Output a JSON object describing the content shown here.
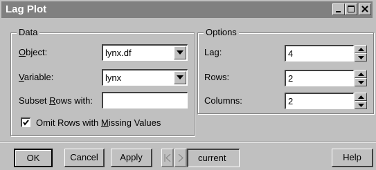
{
  "window": {
    "title": "Lag Plot",
    "controls": [
      "minimize-icon",
      "maximize-icon",
      "close-icon"
    ]
  },
  "data_group": {
    "legend": "Data",
    "object_label_accel": "O",
    "object_label_rest": "bject:",
    "object_value": "lynx.df",
    "variable_label_accel": "V",
    "variable_label_rest": "ariable:",
    "variable_value": "lynx",
    "subset_label_pre": "Subset ",
    "subset_label_accel": "R",
    "subset_label_rest": "ows with:",
    "subset_value": "",
    "omit_label_pre": "Omit Rows with ",
    "omit_label_accel": "M",
    "omit_label_rest": "issing Values",
    "omit_checked": true
  },
  "options_group": {
    "legend": "Options",
    "lag_label": "Lag:",
    "lag_value": "4",
    "rows_label": "Rows:",
    "rows_value": "2",
    "columns_label": "Columns:",
    "columns_value": "2"
  },
  "buttons": {
    "ok": "OK",
    "cancel": "Cancel",
    "apply": "Apply",
    "current": "current",
    "help": "Help"
  }
}
